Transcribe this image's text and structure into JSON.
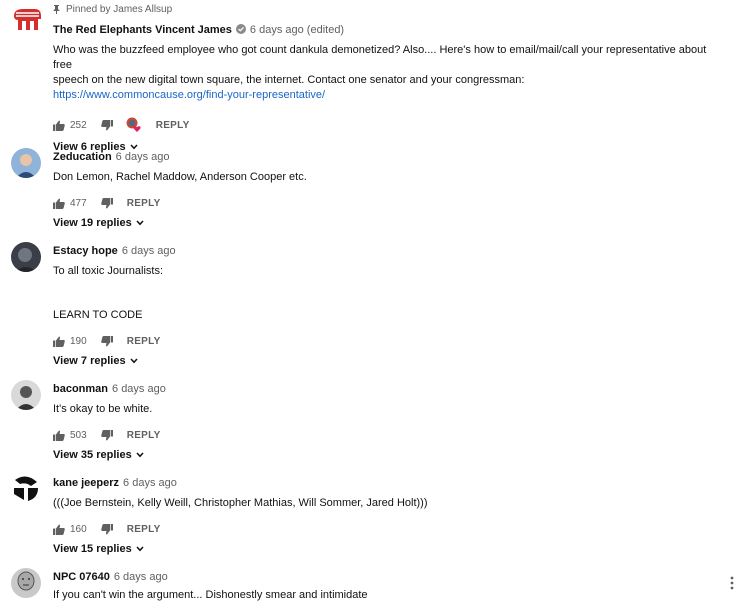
{
  "pinned_label": "Pinned by James Allsup",
  "reply_label": "REPLY",
  "comments": [
    {
      "author": "The Red Elephants Vincent James",
      "meta": "6 days ago (edited)",
      "text_line1": "Who was the buzzfeed employee who got count dankula demonetized? Also.... Here's how to email/mail/call your representative about free",
      "text_line2": "speech on the new digital town square, the internet. Contact one senator and your congressman:",
      "link": "https://www.commoncause.org/find-your-representative/",
      "likes": "252",
      "view_replies": "View 6 replies"
    },
    {
      "author": "Zeducation",
      "meta": "6 days ago",
      "text": "Don Lemon, Rachel Maddow, Anderson Cooper etc.",
      "likes": "477",
      "view_replies": "View 19 replies"
    },
    {
      "author": "Estacy hope",
      "meta": "6 days ago",
      "text_line1": "To all toxic Journalists:",
      "text_line2": "LEARN TO CODE",
      "likes": "190",
      "view_replies": "View 7 replies"
    },
    {
      "author": "baconman",
      "meta": "6 days ago",
      "text": "It's okay to be white.",
      "likes": "503",
      "view_replies": "View 35 replies"
    },
    {
      "author": "kane jeeperz",
      "meta": "6 days ago",
      "text": "(((Joe Bernstein, Kelly Weill, Christopher Mathias, Will Sommer, Jared Holt)))",
      "likes": "160",
      "view_replies": "View 15 replies"
    },
    {
      "author": "NPC 07640",
      "meta": "6 days ago",
      "text": "If you can't win the argument... Dishonestly smear and intimidate"
    }
  ],
  "colors": {
    "link": "#1a65c7",
    "meta": "#606060",
    "heart": "#e0245e",
    "elephant": "#d32f2f"
  },
  "icons": [
    "pin-icon",
    "verified-icon",
    "thumb-up-icon",
    "thumb-down-icon",
    "creator-heart-icon",
    "chevron-down-icon",
    "more-vert-icon"
  ]
}
